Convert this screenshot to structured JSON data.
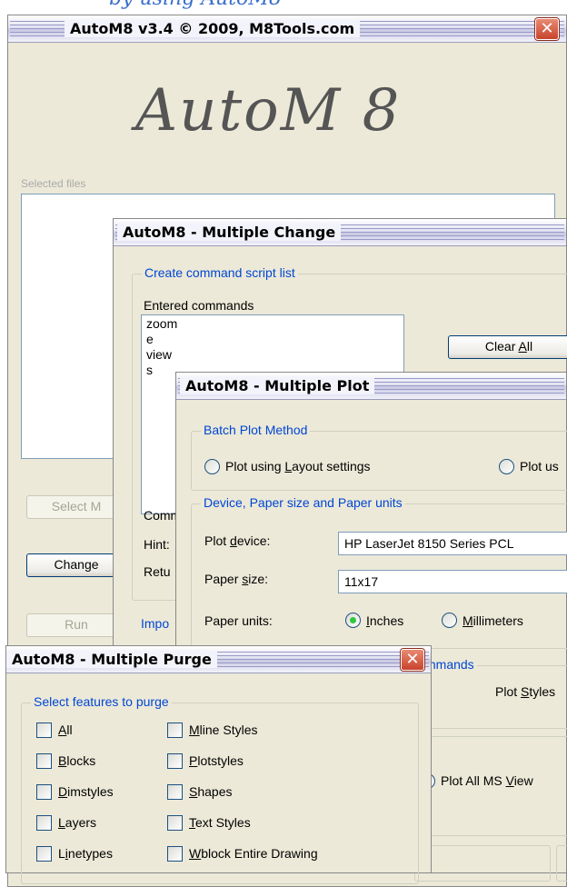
{
  "main": {
    "title": "AutoM8 v3.4 © 2009, M8Tools.com",
    "logo": "AutoM 8",
    "selected_files_label": "Selected files",
    "select_button": "Select M",
    "change_button": "Change",
    "run_button": "Run"
  },
  "change": {
    "title": "AutoM8 - Multiple Change",
    "group_label": "Create command script list",
    "entered_label": "Entered commands",
    "commands": [
      "zoom",
      "e",
      "view",
      "s"
    ],
    "clear_all": "Clear All",
    "comm_label": "Comm",
    "hint_label": "Hint:",
    "retu_label": "Retu",
    "impo_label": "Impo"
  },
  "plot": {
    "title": "AutoM8 - Multiple Plot",
    "method_group": "Batch Plot Method",
    "opt_layout": "Plot using Layout settings",
    "opt_other": "Plot us",
    "device_group": "Device, Paper size and Paper units",
    "device_label": "Plot device:",
    "device_value": "HP LaserJet 8150 Series PCL",
    "size_label": "Paper size:",
    "size_value": "11x17",
    "units_label": "Paper units:",
    "opt_inches": "Inches",
    "opt_mm": "Millimeters",
    "commands_group": "mmands",
    "plot_styles": "Plot Styles",
    "plot_all_ms": "Plot All MS View"
  },
  "purge": {
    "title": "AutoM8 - Multiple Purge",
    "group_label": "Select features to purge",
    "left": [
      "All",
      "Blocks",
      "Dimstyles",
      "Layers",
      "Linetypes"
    ],
    "right": [
      "Mline Styles",
      "Plotstyles",
      "Shapes",
      "Text Styles",
      "Wblock Entire Drawing"
    ]
  },
  "top_partial_text": "by using AutoM8"
}
